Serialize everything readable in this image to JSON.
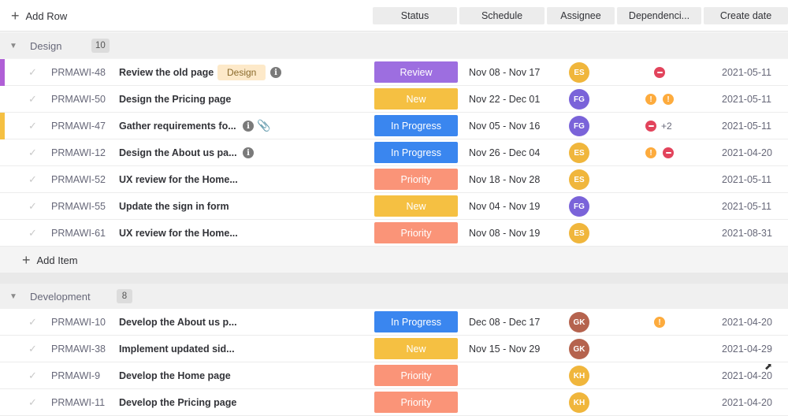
{
  "toolbar": {
    "add_row_label": "Add Row"
  },
  "columns": [
    "Status",
    "Schedule",
    "Assignee",
    "Dependenci...",
    "Create date"
  ],
  "colors": {
    "review": "#9d6ee0",
    "new": "#f5c042",
    "in_progress": "#3a86ef",
    "priority": "#fa9478",
    "avatar_es": "#f0b63c",
    "avatar_fg": "#7a63d9",
    "avatar_gk": "#b5634e",
    "avatar_kh": "#f0b63c"
  },
  "groups": [
    {
      "name": "Design",
      "count": "10",
      "add_item_label": "Add Item",
      "rows": [
        {
          "id": "PRMAWI-48",
          "title": "Review the old page",
          "tag": "Design",
          "status": "Review",
          "schedule": "Nov 08 - Nov 17",
          "assignee": "ES",
          "dependency_more": "",
          "date": "2021-05-11"
        },
        {
          "id": "PRMAWI-50",
          "title": "Design the Pricing page",
          "status": "New",
          "schedule": "Nov 22 - Dec 01",
          "assignee": "FG",
          "dependency_more": "",
          "date": "2021-05-11"
        },
        {
          "id": "PRMAWI-47",
          "title": "Gather requirements fo...",
          "status": "In Progress",
          "schedule": "Nov 05 - Nov 16",
          "assignee": "FG",
          "dependency_more": "+2",
          "date": "2021-05-11"
        },
        {
          "id": "PRMAWI-12",
          "title": "Design the About us pa...",
          "status": "In Progress",
          "schedule": "Nov 26 - Dec 04",
          "assignee": "ES",
          "dependency_more": "",
          "date": "2021-04-20"
        },
        {
          "id": "PRMAWI-52",
          "title": "UX review for the Home...",
          "status": "Priority",
          "schedule": "Nov 18 - Nov 28",
          "assignee": "ES",
          "dependency_more": "",
          "date": "2021-05-11"
        },
        {
          "id": "PRMAWI-55",
          "title": "Update the sign in form",
          "status": "New",
          "schedule": "Nov 04 - Nov 19",
          "assignee": "FG",
          "dependency_more": "",
          "date": "2021-05-11"
        },
        {
          "id": "PRMAWI-61",
          "title": "UX review for the Home...",
          "status": "Priority",
          "schedule": "Nov 08 - Nov 19",
          "assignee": "ES",
          "dependency_more": "",
          "date": "2021-08-31"
        }
      ]
    },
    {
      "name": "Development",
      "count": "8",
      "rows": [
        {
          "id": "PRMAWI-10",
          "title": "Develop the About us p...",
          "status": "In Progress",
          "schedule": "Dec 08 - Dec 17",
          "assignee": "GK",
          "dependency_more": "",
          "date": "2021-04-20"
        },
        {
          "id": "PRMAWI-38",
          "title": "Implement updated sid...",
          "status": "New",
          "schedule": "Nov 15 - Nov 29",
          "assignee": "GK",
          "dependency_more": "",
          "date": "2021-04-29"
        },
        {
          "id": "PRMAWI-9",
          "title": "Develop the Home page",
          "status": "Priority",
          "schedule": "",
          "assignee": "KH",
          "dependency_more": "",
          "date": "2021-04-20"
        },
        {
          "id": "PRMAWI-11",
          "title": "Develop the Pricing page",
          "status": "Priority",
          "schedule": "",
          "assignee": "KH",
          "dependency_more": "",
          "date": "2021-04-20"
        }
      ]
    }
  ]
}
